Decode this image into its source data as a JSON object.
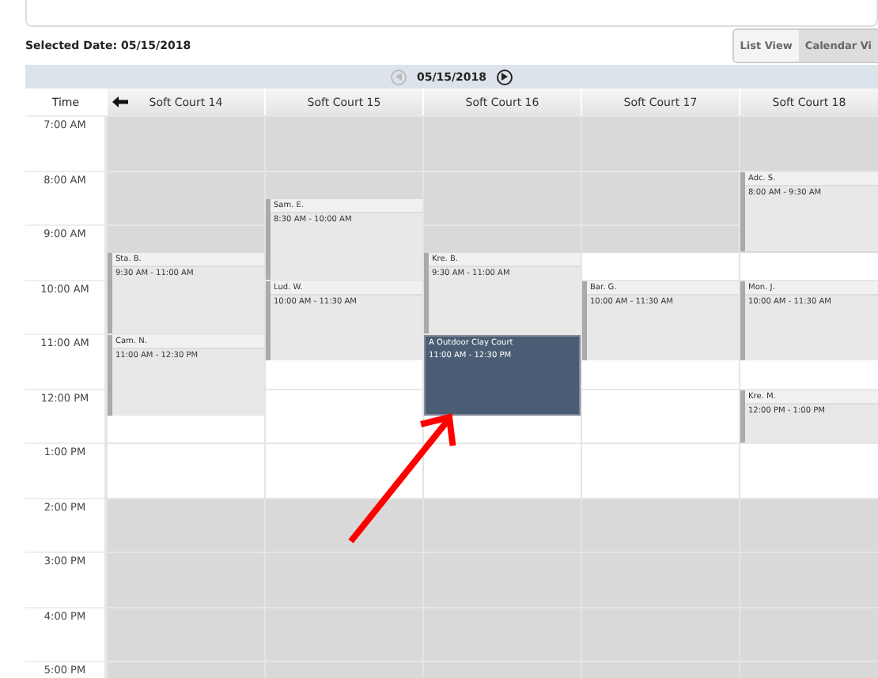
{
  "selected_date": "Selected Date: 05/15/2018",
  "views": [
    {
      "label": "List View",
      "selected": false
    },
    {
      "label": "Calendar Vi",
      "selected": true
    }
  ],
  "nav": {
    "date": "05/15/2018",
    "prev_disabled": true
  },
  "time_heading": "Time",
  "courts": [
    {
      "name": "Soft Court 14",
      "bookings": [
        {
          "name": "Sta. B.",
          "time": "9:30 AM - 11:00 AM",
          "selected": false
        },
        {
          "name": "Cam. N.",
          "time": "11:00 AM - 12:30 PM",
          "selected": false
        }
      ]
    },
    {
      "name": "Soft Court 15",
      "bookings": [
        {
          "name": "Sam. E.",
          "time": "8:30 AM - 10:00 AM",
          "selected": false
        },
        {
          "name": "Lud. W.",
          "time": "10:00 AM - 11:30 AM",
          "selected": false
        }
      ]
    },
    {
      "name": "Soft Court 16",
      "bookings": [
        {
          "name": "Kre. B.",
          "time": "9:30 AM - 11:00 AM",
          "selected": false
        },
        {
          "name": "A Outdoor Clay Court",
          "time": "11:00 AM - 12:30 PM",
          "selected": true
        }
      ]
    },
    {
      "name": "Soft Court 17",
      "bookings": [
        {
          "name": "Bar. G.",
          "time": "10:00 AM - 11:30 AM",
          "selected": false
        }
      ]
    },
    {
      "name": "Soft Court 18",
      "bookings": [
        {
          "name": "Adc. S.",
          "time": "8:00 AM - 9:30 AM",
          "selected": false
        },
        {
          "name": "Mon. J.",
          "time": "10:00 AM - 11:30 AM",
          "selected": false
        },
        {
          "name": "Kre. M.",
          "time": "12:00 PM - 1:00 PM",
          "selected": false
        }
      ]
    }
  ],
  "hours": [
    {
      "label": "7:00 AM",
      "first_half_open": false,
      "second_half_open": false
    },
    {
      "label": "8:00 AM",
      "first_half_open": false,
      "second_half_open": false
    },
    {
      "label": "9:00 AM",
      "first_half_open": false,
      "second_half_open": true
    },
    {
      "label": "10:00 AM"
    },
    {
      "label": "11:00 AM",
      "second_half_open": true
    },
    {
      "label": "12:00 PM",
      "first_half_open": true,
      "second_half_open": true
    },
    {
      "label": "1:00 PM",
      "first_half_open": true,
      "second_half_open": true
    },
    {
      "label": "2:00 PM",
      "first_half_open": false,
      "second_half_open": false
    },
    {
      "label": "3:00 PM",
      "first_half_open": false,
      "second_half_open": false
    },
    {
      "label": "4:00 PM",
      "first_half_open": false,
      "second_half_open": false
    },
    {
      "label": "5:00 PM",
      "first_half_open": false
    }
  ]
}
